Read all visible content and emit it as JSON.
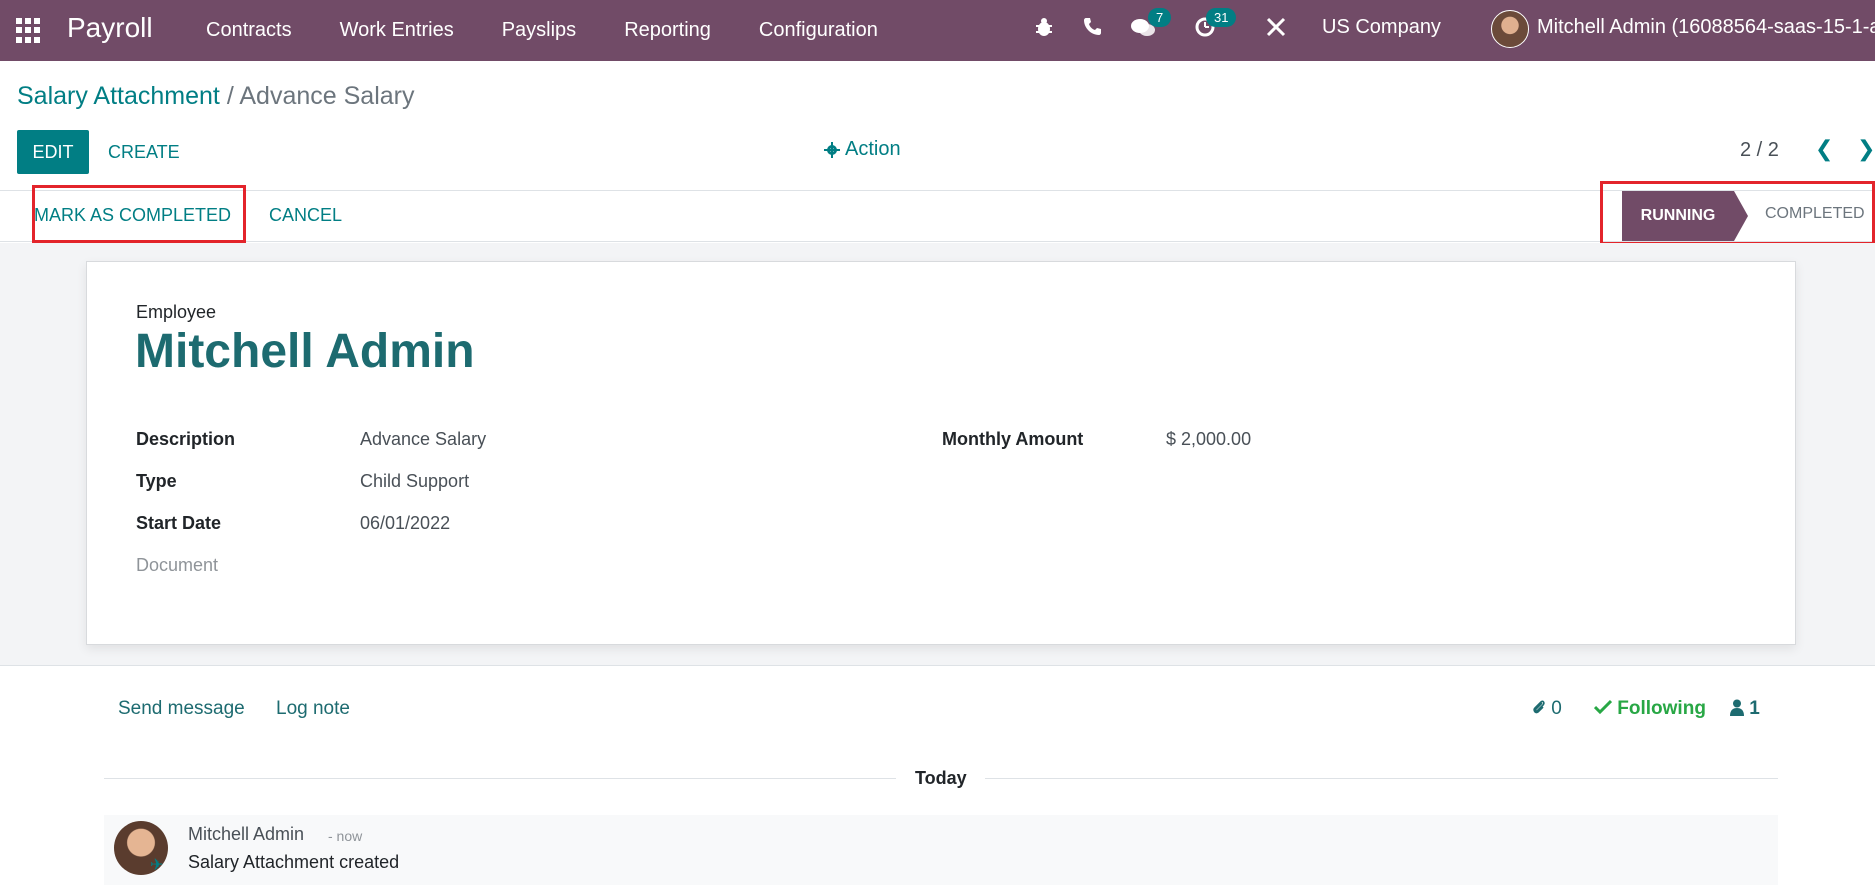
{
  "navbar": {
    "brand": "Payroll",
    "menu": [
      "Contracts",
      "Work Entries",
      "Payslips",
      "Reporting",
      "Configuration"
    ],
    "messages_count": "7",
    "activities_count": "31",
    "company": "US Company",
    "user": "Mitchell Admin (16088564-saas-15-1-all)",
    "bar_color": "#714b67"
  },
  "breadcrumb": {
    "parent": "Salary Attachment",
    "separator": "/",
    "current": "Advance Salary"
  },
  "control": {
    "edit_label": "EDIT",
    "create_label": "CREATE",
    "action_label": "Action",
    "pager": "2 / 2"
  },
  "statusbar": {
    "complete_label": "MARK AS COMPLETED",
    "cancel_label": "CANCEL",
    "stages": [
      "RUNNING",
      "COMPLETED"
    ],
    "active_stage": "RUNNING"
  },
  "form": {
    "employee_label": "Employee",
    "employee_name": "Mitchell Admin",
    "description_label": "Description",
    "description_value": "Advance Salary",
    "type_label": "Type",
    "type_value": "Child Support",
    "start_date_label": "Start Date",
    "start_date_value": "06/01/2022",
    "document_label": "Document",
    "monthly_amount_label": "Monthly Amount",
    "monthly_amount_value": "$ 2,000.00"
  },
  "chatter": {
    "send_message": "Send message",
    "log_note": "Log note",
    "attachments_count": "0",
    "following_label": "Following",
    "followers_count": "1",
    "date_separator": "Today",
    "message": {
      "author": "Mitchell Admin",
      "time": "- now",
      "body": "Salary Attachment created"
    }
  },
  "colors": {
    "primary": "#017e84",
    "brand_purple": "#714b67",
    "highlight": "#e3242b"
  }
}
